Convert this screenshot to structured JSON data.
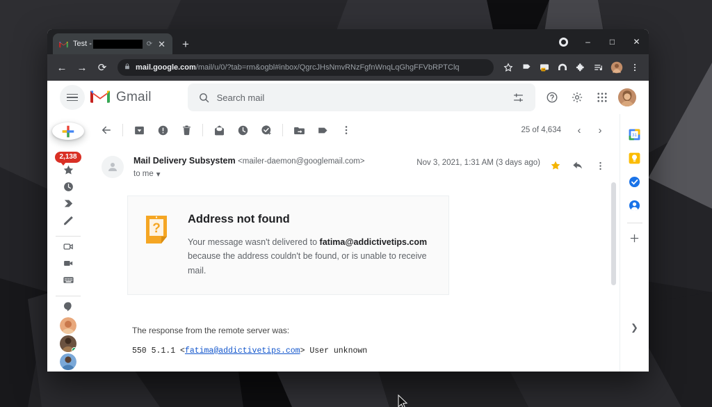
{
  "window": {
    "tab": {
      "title_prefix": "Test -",
      "title_redacted": true,
      "favicon": "gmail-icon",
      "reload_icon": "reload-icon",
      "close_icon": "close-icon"
    },
    "new_tab_label": "+",
    "controls": {
      "profile_dot": "record-dot-icon",
      "minimize": "–",
      "maximize": "□",
      "close": "✕"
    }
  },
  "omnibox": {
    "lock_icon": "lock-icon",
    "domain": "mail.google.com",
    "path": "/mail/u/0/?tab=rm&ogbl#inbox/QgrcJHsNmvRNzFgfnWnqLqGhgFFVbRPTClq",
    "bookmark_icon": "star-outline-icon",
    "extensions": [
      "tag-flag-icon",
      "device-off-icon",
      "arch-bridge-icon",
      "puzzle-extensions-icon",
      "playlist-icon"
    ],
    "profile_avatar": "user-avatar",
    "menu_icon": "three-dot-menu-icon"
  },
  "nav": {
    "back": "←",
    "forward": "→",
    "reload": "⟳"
  },
  "gmail_header": {
    "menu_icon": "hamburger-menu-icon",
    "logo_icon": "gmail-logo-icon",
    "brand": "Gmail",
    "search": {
      "icon": "search-icon",
      "placeholder": "Search mail",
      "value": "",
      "options_icon": "search-options-icon"
    },
    "support_icon": "help-icon",
    "settings_icon": "gear-icon",
    "apps_icon": "apps-grid-icon",
    "account_avatar": "account-avatar"
  },
  "sidebar": {
    "compose": {
      "label": "Compose",
      "icon": "plus-icon"
    },
    "items": [
      {
        "name": "inbox",
        "icon": "inbox-badge",
        "badge": "2,138"
      },
      {
        "name": "starred",
        "icon": "star-icon"
      },
      {
        "name": "snoozed",
        "icon": "clock-icon"
      },
      {
        "name": "sent",
        "icon": "send-arrow-icon"
      },
      {
        "name": "drafts",
        "icon": "pencil-icon"
      }
    ],
    "meet_items": [
      {
        "name": "new-meeting",
        "icon": "video-new-icon"
      },
      {
        "name": "join-meeting",
        "icon": "video-camera-icon"
      },
      {
        "name": "keyboard",
        "icon": "keyboard-icon"
      }
    ],
    "chat_items": [
      {
        "name": "hangouts",
        "icon": "hangouts-icon"
      },
      {
        "name": "contact-1",
        "icon": "contact-avatar"
      },
      {
        "name": "contact-2",
        "icon": "contact-avatar",
        "presence": "online"
      },
      {
        "name": "contact-3",
        "icon": "contact-avatar"
      }
    ]
  },
  "message_toolbar": {
    "back_icon": "back-arrow-icon",
    "archive_icon": "archive-icon",
    "spam_icon": "report-spam-icon",
    "delete_icon": "trash-icon",
    "unread_icon": "mark-unread-icon",
    "snooze_icon": "snooze-clock-icon",
    "tasks_icon": "add-to-tasks-icon",
    "move_icon": "move-to-folder-icon",
    "label_icon": "labels-icon",
    "more_icon": "more-vertical-icon",
    "pager": {
      "text": "25 of 4,634",
      "prev_icon": "chevron-left-icon",
      "next_icon": "chevron-right-icon"
    }
  },
  "message": {
    "avatar": "generic-person-avatar",
    "sender_name": "Mail Delivery Subsystem",
    "sender_address": "<mailer-daemon@googlemail.com>",
    "recipient": "to me",
    "recipient_caret": "▾",
    "date": "Nov 3, 2021, 1:31 AM (3 days ago)",
    "star_icon": "star-filled-icon",
    "star_color": "#f4b400",
    "reply_icon": "reply-arrow-icon",
    "more_icon": "more-vertical-icon",
    "error_card": {
      "icon": "question-document-icon",
      "icon_color": "#f5a623",
      "title": "Address not found",
      "body_before": "Your message wasn't delivered to ",
      "body_bold": "fatima@addictivetips.com",
      "body_after": " because the address couldn't be found, or is unable to receive mail."
    },
    "response_label": "The response from the remote server was:",
    "response_code_prefix": "550 5.1.1 <",
    "response_code_link": "fatima@addictivetips.com",
    "response_code_suffix": "> User unknown"
  },
  "addons": {
    "items": [
      {
        "name": "google-calendar",
        "icon": "calendar-icon",
        "color": "#4285f4"
      },
      {
        "name": "google-keep",
        "icon": "keep-bulb-icon",
        "color": "#fbbc04"
      },
      {
        "name": "google-tasks",
        "icon": "tasks-check-icon",
        "color": "#1a73e8"
      },
      {
        "name": "google-contacts",
        "icon": "contacts-person-icon",
        "color": "#1a73e8"
      }
    ],
    "add_icon": "plus-icon",
    "expand_icon": "chevron-right-icon"
  },
  "colors": {
    "gmail_red": "#ea4335",
    "badge_red": "#d93025",
    "link_blue": "#1155cc",
    "star_gold": "#f4b400",
    "error_orange": "#f5a623"
  }
}
